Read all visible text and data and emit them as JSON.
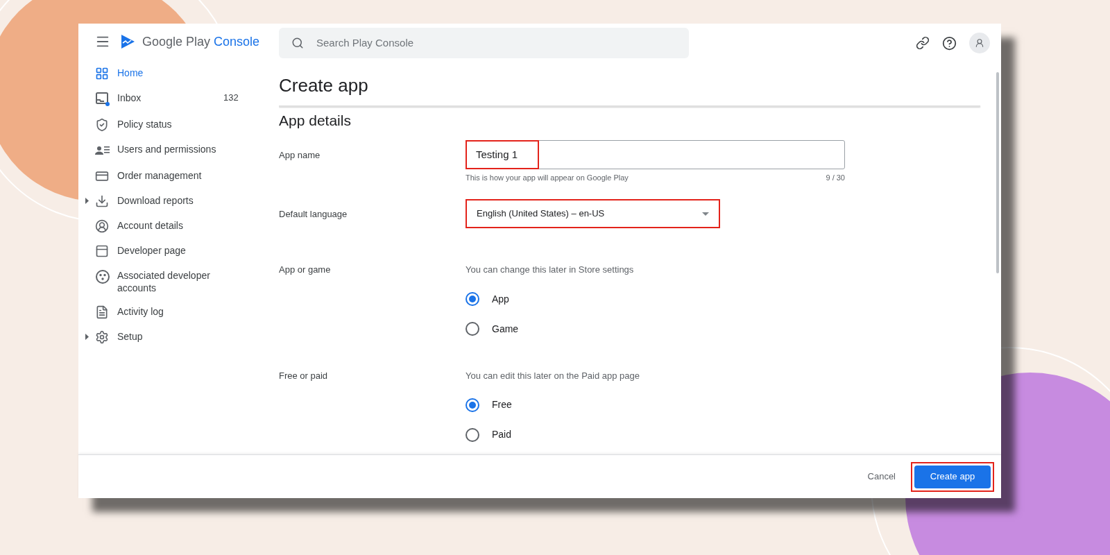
{
  "header": {
    "logo_text": "Google Play",
    "logo_product": "Console",
    "search": {
      "placeholder": "Search Play Console"
    }
  },
  "sidebar": {
    "items": [
      {
        "label": "Home",
        "selected": true,
        "expandable": false
      },
      {
        "label": "Inbox",
        "selected": false,
        "expandable": false,
        "count": "132"
      },
      {
        "label": "Policy status",
        "selected": false,
        "expandable": false
      },
      {
        "label": "Users and permissions",
        "selected": false,
        "expandable": false
      },
      {
        "label": "Order management",
        "selected": false,
        "expandable": false
      },
      {
        "label": "Download reports",
        "selected": false,
        "expandable": true
      },
      {
        "label": "Account details",
        "selected": false,
        "expandable": false
      },
      {
        "label": "Developer page",
        "selected": false,
        "expandable": false
      },
      {
        "label": "Associated developer accounts",
        "selected": false,
        "expandable": false
      },
      {
        "label": "Activity log",
        "selected": false,
        "expandable": false
      },
      {
        "label": "Setup",
        "selected": false,
        "expandable": true
      }
    ]
  },
  "page": {
    "title": "Create app",
    "section": "App details",
    "app_name": {
      "label": "App name",
      "value": "Testing 1",
      "highlighted": true,
      "hint": "This is how your app will appear on Google Play",
      "counter": "9 / 30"
    },
    "default_language": {
      "label": "Default language",
      "value": "English (United States) – en-US",
      "highlighted": true
    },
    "radio_groups": [
      {
        "label": "App or game",
        "hint": "You can change this later in Store settings",
        "options": [
          {
            "label": "App",
            "selected": true
          },
          {
            "label": "Game",
            "selected": false
          }
        ]
      },
      {
        "label": "Free or paid",
        "hint": "You can edit this later on the Paid app page",
        "options": [
          {
            "label": "Free",
            "selected": true
          },
          {
            "label": "Paid",
            "selected": false
          }
        ]
      }
    ]
  },
  "footer": {
    "cancel": "Cancel",
    "submit": {
      "label": "Create app",
      "highlighted": true
    }
  }
}
